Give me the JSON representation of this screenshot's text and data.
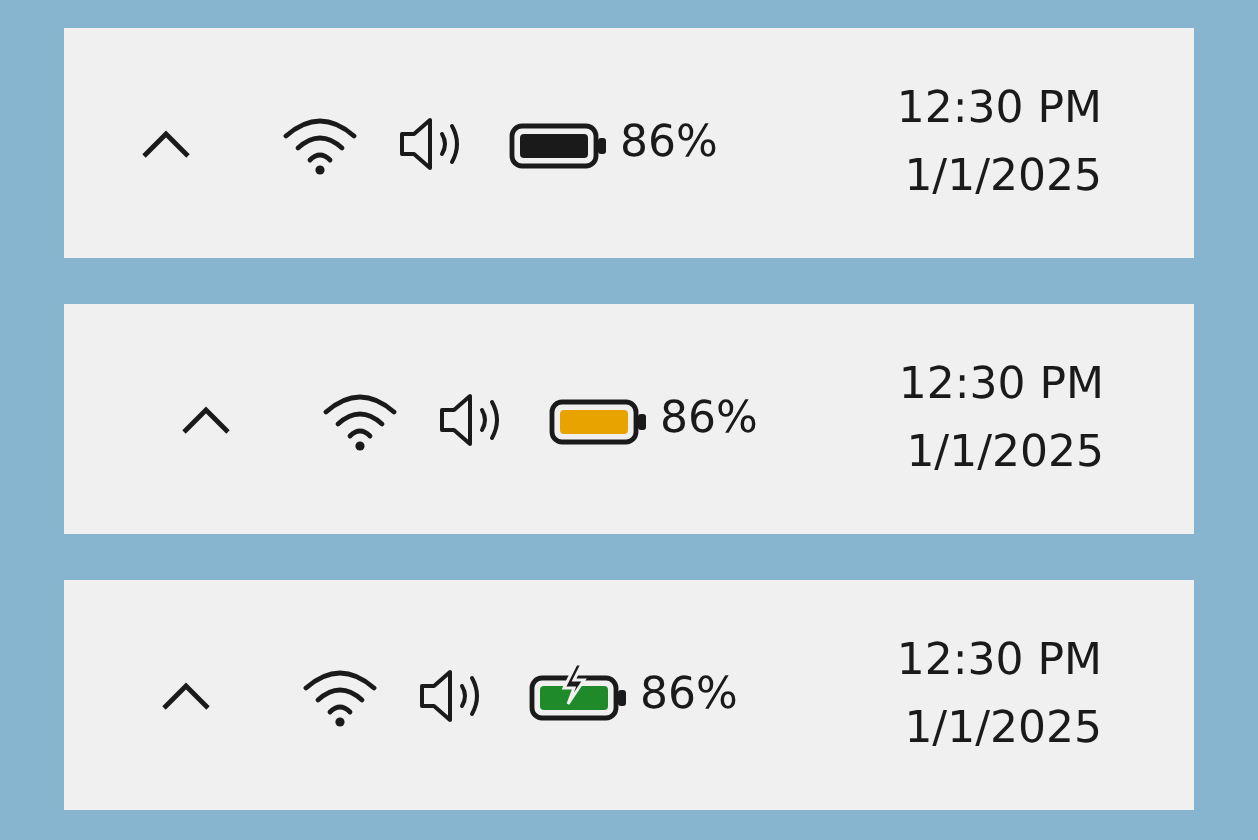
{
  "trays": [
    {
      "battery": {
        "color": "#1a1a1a",
        "charging": false
      },
      "percent": "86%",
      "time": "12:30 PM",
      "date": "1/1/2025"
    },
    {
      "battery": {
        "color": "#e8a300",
        "charging": false
      },
      "percent": "86%",
      "time": "12:30 PM",
      "date": "1/1/2025"
    },
    {
      "battery": {
        "color": "#1f8a2a",
        "charging": true
      },
      "percent": "86%",
      "time": "12:30 PM",
      "date": "1/1/2025"
    }
  ]
}
